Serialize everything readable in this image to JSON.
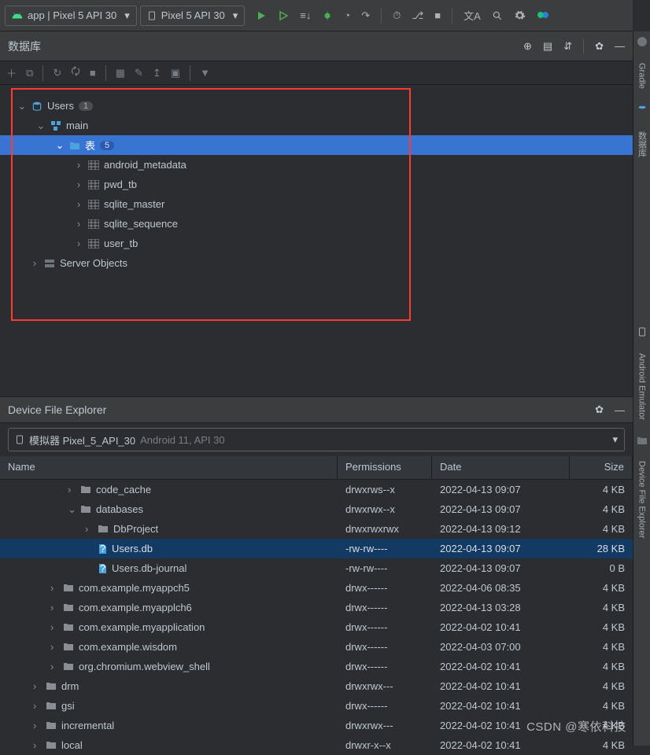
{
  "topbar": {
    "run_config": "app | Pixel 5 API 30",
    "device": "Pixel 5 API 30"
  },
  "db_panel": {
    "title": "数据库",
    "tree": {
      "root": {
        "label": "Users",
        "badge": "1"
      },
      "main": {
        "label": "main"
      },
      "tables_folder": {
        "label": "表",
        "badge": "5"
      },
      "tables": [
        "android_metadata",
        "pwd_tb",
        "sqlite_master",
        "sqlite_sequence",
        "user_tb"
      ],
      "server_objects": "Server Objects"
    }
  },
  "dfe": {
    "title": "Device File Explorer",
    "device_label": "模拟器 Pixel_5_API_30",
    "device_sub": "Android 11, API 30",
    "headers": {
      "name": "Name",
      "perm": "Permissions",
      "date": "Date",
      "size": "Size"
    },
    "rows": [
      {
        "indent": 3,
        "chev": "›",
        "icon": "folder",
        "name": "code_cache",
        "perm": "drwxrws--x",
        "date": "2022-04-13 09:07",
        "size": "4 KB",
        "sel": false
      },
      {
        "indent": 3,
        "chev": "⌄",
        "icon": "folder",
        "name": "databases",
        "perm": "drwxrwx--x",
        "date": "2022-04-13 09:07",
        "size": "4 KB",
        "sel": false
      },
      {
        "indent": 4,
        "chev": "›",
        "icon": "folder",
        "name": "DbProject",
        "perm": "drwxrwxrwx",
        "date": "2022-04-13 09:12",
        "size": "4 KB",
        "sel": false
      },
      {
        "indent": 4,
        "chev": "",
        "icon": "file",
        "name": "Users.db",
        "perm": "-rw-rw----",
        "date": "2022-04-13 09:07",
        "size": "28 KB",
        "sel": true
      },
      {
        "indent": 4,
        "chev": "",
        "icon": "file",
        "name": "Users.db-journal",
        "perm": "-rw-rw----",
        "date": "2022-04-13 09:07",
        "size": "0 B",
        "sel": false
      },
      {
        "indent": 2,
        "chev": "›",
        "icon": "folder",
        "name": "com.example.myappch5",
        "perm": "drwx------",
        "date": "2022-04-06 08:35",
        "size": "4 KB",
        "sel": false
      },
      {
        "indent": 2,
        "chev": "›",
        "icon": "folder",
        "name": "com.example.myapplch6",
        "perm": "drwx------",
        "date": "2022-04-13 03:28",
        "size": "4 KB",
        "sel": false
      },
      {
        "indent": 2,
        "chev": "›",
        "icon": "folder",
        "name": "com.example.myapplication",
        "perm": "drwx------",
        "date": "2022-04-02 10:41",
        "size": "4 KB",
        "sel": false
      },
      {
        "indent": 2,
        "chev": "›",
        "icon": "folder",
        "name": "com.example.wisdom",
        "perm": "drwx------",
        "date": "2022-04-03 07:00",
        "size": "4 KB",
        "sel": false
      },
      {
        "indent": 2,
        "chev": "›",
        "icon": "folder",
        "name": "org.chromium.webview_shell",
        "perm": "drwx------",
        "date": "2022-04-02 10:41",
        "size": "4 KB",
        "sel": false
      },
      {
        "indent": 1,
        "chev": "›",
        "icon": "folder",
        "name": "drm",
        "perm": "drwxrwx---",
        "date": "2022-04-02 10:41",
        "size": "4 KB",
        "sel": false
      },
      {
        "indent": 1,
        "chev": "›",
        "icon": "folder",
        "name": "gsi",
        "perm": "drwx------",
        "date": "2022-04-02 10:41",
        "size": "4 KB",
        "sel": false
      },
      {
        "indent": 1,
        "chev": "›",
        "icon": "folder",
        "name": "incremental",
        "perm": "drwxrwx---",
        "date": "2022-04-02 10:41",
        "size": "4 KB",
        "sel": false
      },
      {
        "indent": 1,
        "chev": "›",
        "icon": "folder",
        "name": "local",
        "perm": "drwxr-x--x",
        "date": "2022-04-02 10:41",
        "size": "4 KB",
        "sel": false
      }
    ]
  },
  "sidetabs": {
    "gradle": "Gradle",
    "db": "数据库",
    "emulator": "Android Emulator",
    "dfe": "Device File Explorer"
  },
  "watermark": "CSDN @寒依科技"
}
